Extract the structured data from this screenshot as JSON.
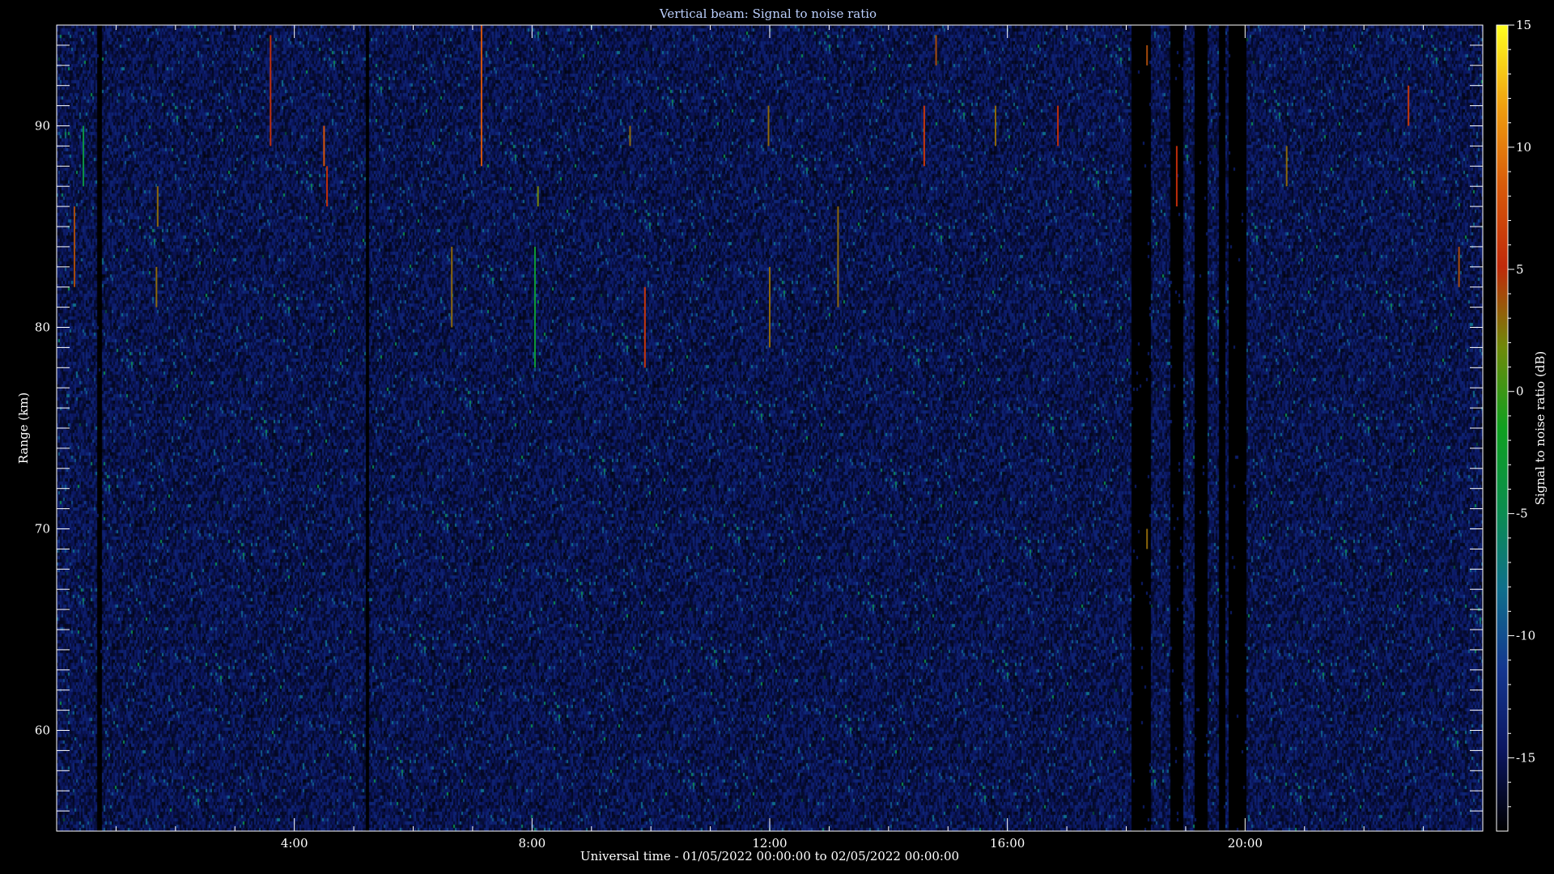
{
  "chart_data": {
    "type": "heatmap",
    "title": "Vertical beam: Signal to noise ratio",
    "xlabel": "Universal time - 01/05/2022 00:00:00 to 02/05/2022 00:00:00",
    "ylabel": "Range (km)",
    "colorbar_label": "Signal to noise ratio (dB)",
    "x_unit": "hours UT",
    "xlim": [
      0,
      24
    ],
    "ylim": [
      55,
      95
    ],
    "zlim": [
      -18,
      15
    ],
    "x_ticks": [
      {
        "value": 4,
        "label": "4:00"
      },
      {
        "value": 8,
        "label": "8:00"
      },
      {
        "value": 12,
        "label": "12:00"
      },
      {
        "value": 16,
        "label": "16:00"
      },
      {
        "value": 20,
        "label": "20:00"
      }
    ],
    "y_ticks": [
      {
        "value": 60,
        "label": "60"
      },
      {
        "value": 70,
        "label": "70"
      },
      {
        "value": 80,
        "label": "80"
      },
      {
        "value": 90,
        "label": "90"
      }
    ],
    "colorbar_ticks": [
      {
        "value": -15,
        "label": "-15"
      },
      {
        "value": -10,
        "label": "-10"
      },
      {
        "value": -5,
        "label": "-5"
      },
      {
        "value": 0,
        "label": "0"
      },
      {
        "value": 5,
        "label": "5"
      },
      {
        "value": 10,
        "label": "10"
      },
      {
        "value": 15,
        "label": "15"
      }
    ],
    "background_level_db": -15,
    "data_gaps_hours": [
      [
        0.67,
        0.75
      ],
      [
        5.18,
        5.25
      ],
      [
        18.08,
        18.4
      ],
      [
        18.72,
        18.95
      ],
      [
        19.15,
        19.35
      ],
      [
        19.55,
        19.65
      ],
      [
        19.72,
        20.0
      ]
    ],
    "echoes": [
      {
        "time": 0.3,
        "range_top": 86,
        "range_bottom": 82,
        "snr": 4
      },
      {
        "time": 0.45,
        "range_top": 90,
        "range_bottom": 87,
        "snr": -4
      },
      {
        "time": 1.7,
        "range_top": 87,
        "range_bottom": 85,
        "snr": 3
      },
      {
        "time": 1.68,
        "range_top": 83,
        "range_bottom": 81,
        "snr": 3
      },
      {
        "time": 3.6,
        "range_top": 94.5,
        "range_bottom": 89,
        "snr": 5
      },
      {
        "time": 4.5,
        "range_top": 90,
        "range_bottom": 88,
        "snr": 8
      },
      {
        "time": 4.55,
        "range_top": 88,
        "range_bottom": 86,
        "snr": 5
      },
      {
        "time": 7.15,
        "range_top": 95,
        "range_bottom": 88,
        "snr": 8
      },
      {
        "time": 6.65,
        "range_top": 84,
        "range_bottom": 80,
        "snr": 3
      },
      {
        "time": 8.05,
        "range_top": 84,
        "range_bottom": 78,
        "snr": -3
      },
      {
        "time": 8.1,
        "range_top": 87,
        "range_bottom": 86,
        "snr": 2
      },
      {
        "time": 9.65,
        "range_top": 90,
        "range_bottom": 89,
        "snr": 3
      },
      {
        "time": 9.9,
        "range_top": 82,
        "range_bottom": 78,
        "snr": 6
      },
      {
        "time": 12.0,
        "range_top": 83,
        "range_bottom": 79,
        "snr": 3
      },
      {
        "time": 11.98,
        "range_top": 91,
        "range_bottom": 89,
        "snr": 3
      },
      {
        "time": 13.15,
        "range_top": 86,
        "range_bottom": 81,
        "snr": 3
      },
      {
        "time": 14.6,
        "range_top": 91,
        "range_bottom": 88,
        "snr": 6
      },
      {
        "time": 14.8,
        "range_top": 94.5,
        "range_bottom": 93,
        "snr": 4
      },
      {
        "time": 15.8,
        "range_top": 91,
        "range_bottom": 89,
        "snr": 3
      },
      {
        "time": 16.85,
        "range_top": 91,
        "range_bottom": 89,
        "snr": 5
      },
      {
        "time": 18.35,
        "range_top": 94,
        "range_bottom": 93,
        "snr": 4
      },
      {
        "time": 18.35,
        "range_top": 70,
        "range_bottom": 69,
        "snr": 3
      },
      {
        "time": 18.85,
        "range_top": 89,
        "range_bottom": 86,
        "snr": 5
      },
      {
        "time": 20.7,
        "range_top": 89,
        "range_bottom": 87,
        "snr": 3
      },
      {
        "time": 22.75,
        "range_top": 92,
        "range_bottom": 90,
        "snr": 6
      },
      {
        "time": 23.6,
        "range_top": 84,
        "range_bottom": 82,
        "snr": 4
      }
    ],
    "colormap": [
      "#000000",
      "#0b1660",
      "#14368f",
      "#0f6f8c",
      "#0b8e4e",
      "#0fa020",
      "#6f8a0a",
      "#c02a0a",
      "#d85a0a",
      "#f0a010",
      "#ffff20"
    ],
    "grid": false
  }
}
